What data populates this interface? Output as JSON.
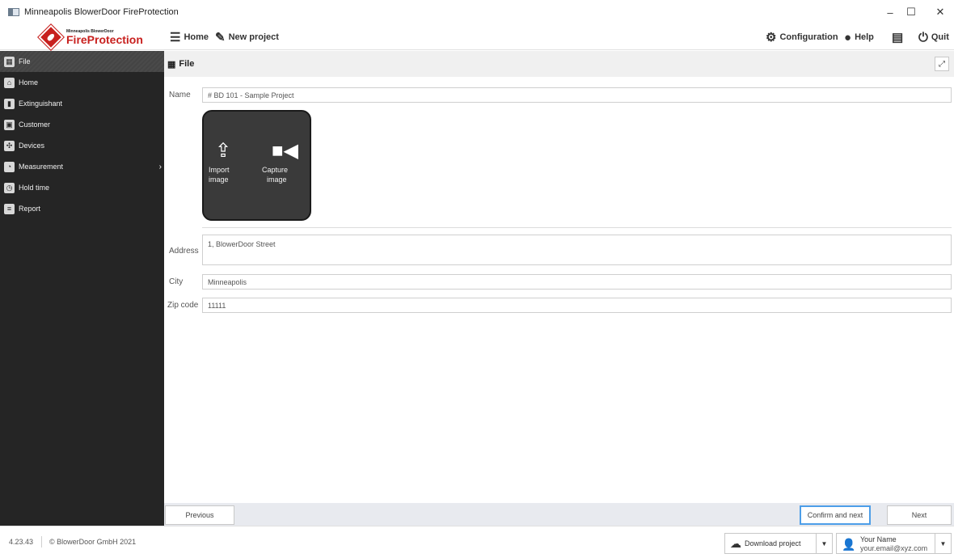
{
  "window": {
    "title": "Minneapolis BlowerDoor FireProtection",
    "controls": {
      "minimize": "–",
      "maximize": "☐",
      "close": "✕"
    }
  },
  "toolbar": {
    "logo_small": "Minneapolis BlowerDoor",
    "logo_big": "FireProtection",
    "home_label": "Home",
    "new_project_label": "New project",
    "configuration_label": "Configuration",
    "help_label": "Help",
    "quit_label": "Quit"
  },
  "sidebar": {
    "items": [
      {
        "label": "File",
        "icon": "building-icon",
        "active": true
      },
      {
        "label": "Home",
        "icon": "home-icon"
      },
      {
        "label": "Extinguishant",
        "icon": "extinguisher-icon"
      },
      {
        "label": "Customer",
        "icon": "contact-card-icon"
      },
      {
        "label": "Devices",
        "icon": "fan-icon"
      },
      {
        "label": "Measurement",
        "icon": "gauge-icon",
        "has_submenu": true
      },
      {
        "label": "Hold time",
        "icon": "stopwatch-icon"
      },
      {
        "label": "Report",
        "icon": "report-icon"
      }
    ]
  },
  "main": {
    "header_title": "File",
    "form": {
      "name_label": "Name",
      "name_value": "# BD 101 - Sample Project",
      "image": {
        "import_label_1": "Import",
        "import_label_2": "image",
        "capture_label_1": "Capture",
        "capture_label_2": "image"
      },
      "address_label": "Address",
      "address_value": "1, BlowerDoor Street",
      "city_label": "City",
      "city_value": "Minneapolis",
      "zip_label": "Zip code",
      "zip_value": "11111"
    },
    "nav": {
      "previous_label": "Previous",
      "confirm_next_label": "Confirm and next",
      "next_label": "Next"
    }
  },
  "statusbar": {
    "version": "4.23.43",
    "copyright": "© BlowerDoor GmbH 2021",
    "download_label": "Download project",
    "user_name": "Your Name",
    "user_email": "your.email@xyz.com"
  },
  "colors": {
    "sidebar_bg": "#252525",
    "brand_red": "#c8201e",
    "focus_blue": "#4d9ee8"
  }
}
